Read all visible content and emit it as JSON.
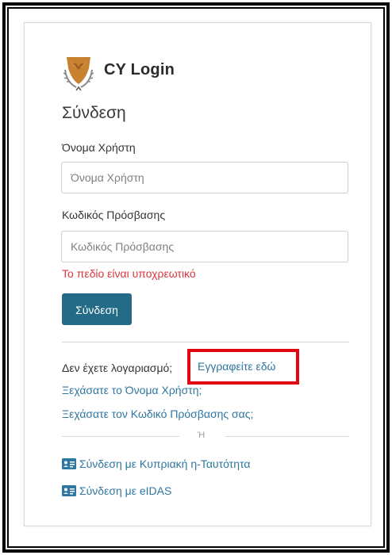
{
  "header": {
    "app_title": "CY Login"
  },
  "login": {
    "title": "Σύνδεση",
    "username_label": "Όνομα Χρήστη",
    "username_placeholder": "Όνομα Χρήστη",
    "password_label": "Κωδικός Πρόσβασης",
    "password_placeholder": "Κωδικός Πρόσβασης",
    "error_text": "Το πεδίο είναι υποχρεωτικό",
    "submit_label": "Σύνδεση"
  },
  "links": {
    "no_account_text": "Δεν έχετε λογαριασμό;",
    "register_link": "Εγγραφείτε εδώ",
    "forgot_username": "Ξεχάσατε το Όνομα Χρήστη;",
    "forgot_password": "Ξεχάσατε τον Κωδικό Πρόσβασης σας;",
    "or_separator": "Ή",
    "cyprus_id_login": "Σύνδεση με Κυπριακή η-Ταυτότητα",
    "eidas_login": "Σύνδεση με eIDAS"
  },
  "colors": {
    "button": "#236b87",
    "link": "#2e77a0",
    "error": "#d9363e",
    "highlight": "#e30613",
    "logo_copper": "#c8812e"
  },
  "icons": [
    "cyprus-emblem-icon",
    "id-card-icon"
  ]
}
